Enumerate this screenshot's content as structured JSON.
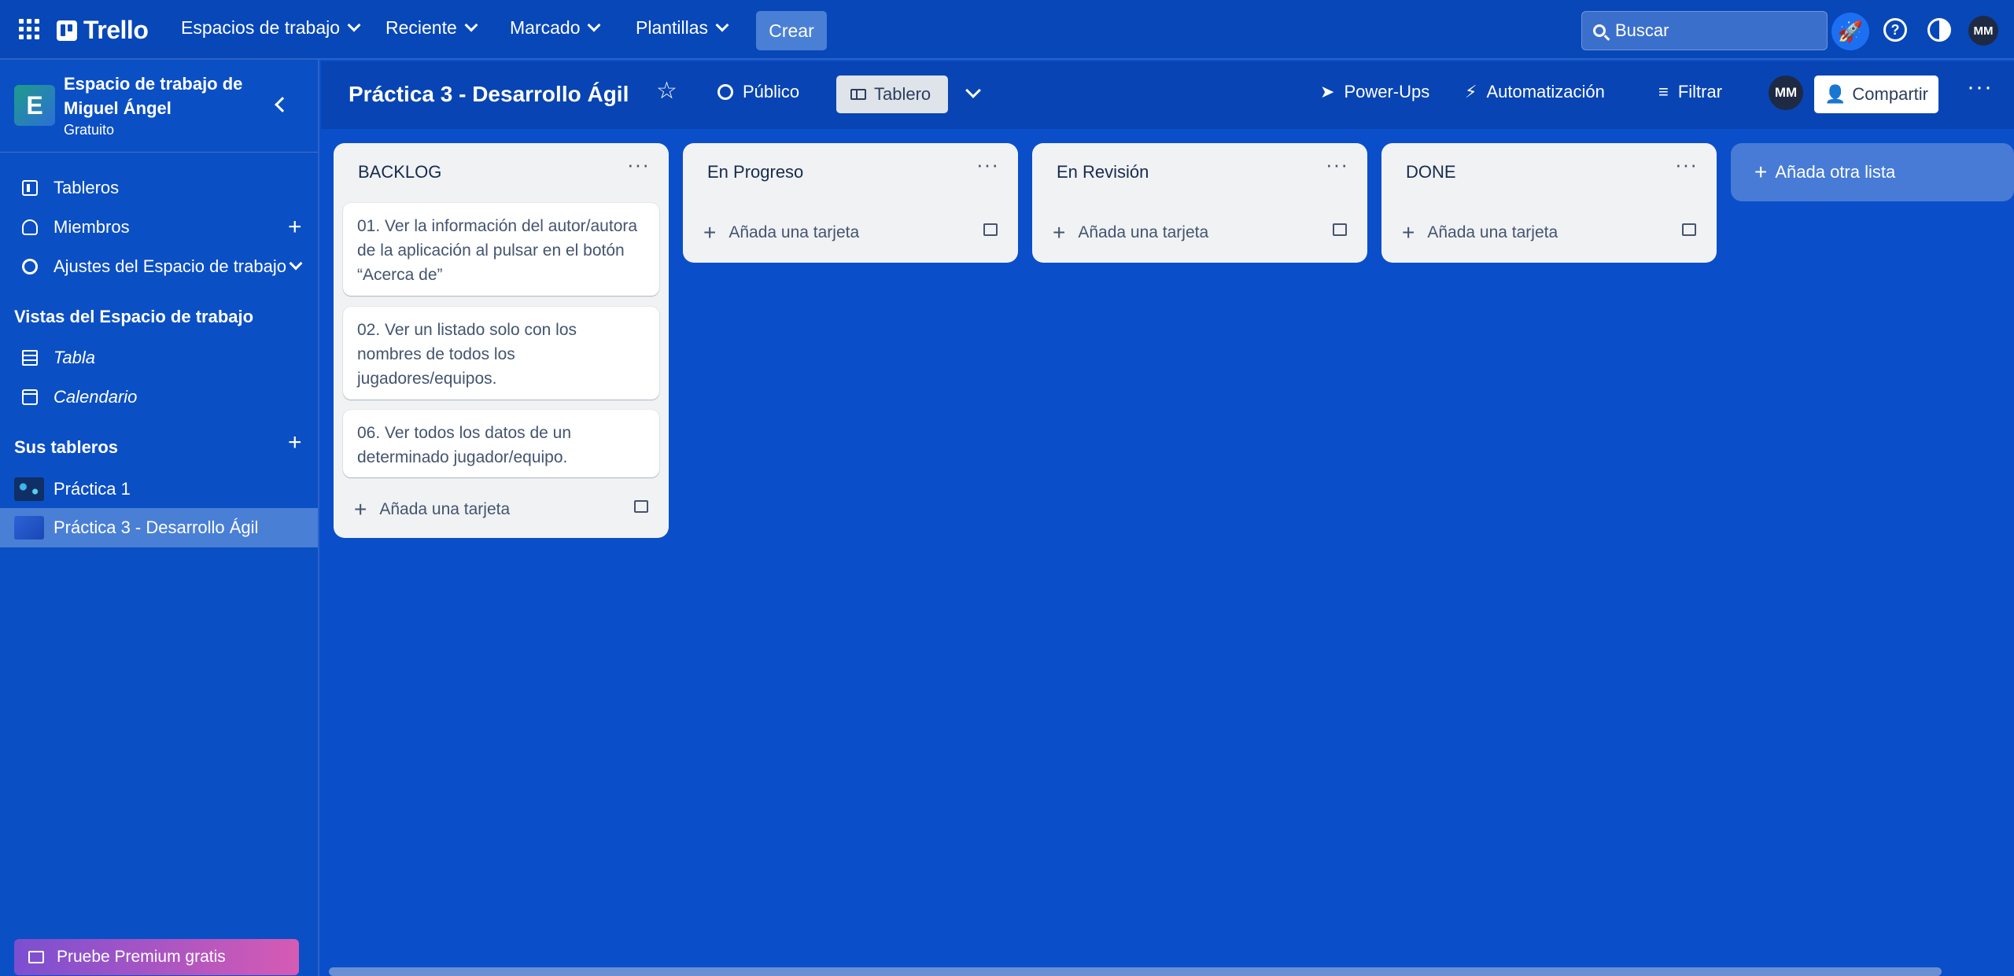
{
  "topnav": {
    "logo": "Trello",
    "menus": [
      "Espacios de trabajo",
      "Reciente",
      "Marcado",
      "Plantillas"
    ],
    "create": "Crear",
    "search_placeholder": "Buscar",
    "avatar": "MM"
  },
  "sidebar": {
    "workspace_name": "Espacio de trabajo de Miguel Ángel",
    "workspace_initial": "E",
    "plan": "Gratuito",
    "items": {
      "boards": "Tableros",
      "members": "Miembros",
      "settings": "Ajustes del Espacio de trabajo"
    },
    "views_heading": "Vistas del Espacio de trabajo",
    "views": {
      "table": "Tabla",
      "calendar": "Calendario"
    },
    "boards_heading": "Sus tableros",
    "boards": [
      "Práctica 1",
      "Práctica 3 - Desarrollo Ágil"
    ],
    "premium": "Pruebe Premium gratis"
  },
  "board_header": {
    "title": "Práctica 3 - Desarrollo Ágil",
    "visibility": "Público",
    "view": "Tablero",
    "powerups": "Power-Ups",
    "automation": "Automatización",
    "filter": "Filtrar",
    "avatar": "MM",
    "share": "Compartir"
  },
  "lists": [
    {
      "title": "BACKLOG",
      "cards": [
        "01. Ver la información del autor/autora de la aplicación al pulsar en el botón “Acerca de”",
        "02. Ver un listado solo con los nombres de todos los jugadores/equipos.",
        "06. Ver todos los datos de un determinado jugador/equipo."
      ],
      "add_card": "Añada una tarjeta"
    },
    {
      "title": "En Progreso",
      "cards": [],
      "add_card": "Añada una tarjeta"
    },
    {
      "title": "En Revisión",
      "cards": [],
      "add_card": "Añada una tarjeta"
    },
    {
      "title": "DONE",
      "cards": [],
      "add_card": "Añada una tarjeta"
    }
  ],
  "add_list": "Añada otra lista"
}
